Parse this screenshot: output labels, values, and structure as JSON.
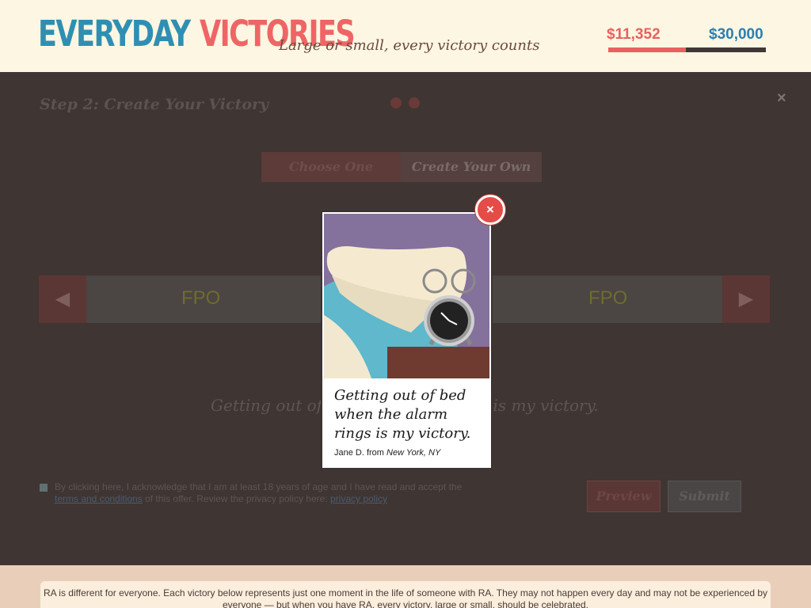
{
  "header": {
    "logo_word1": "EVERYDAY",
    "logo_word2": "VICTORIES",
    "tagline": "Large or small, every victory counts",
    "raised": "$11,352",
    "goal": "$30,000",
    "progress_fraction": 0.49,
    "colors": {
      "brand_blue": "#2f8fb3",
      "brand_red": "#ef6565"
    }
  },
  "wizard": {
    "step_title": "Step 2: Create Your Victory",
    "close_icon": "×",
    "tabs": [
      "Choose One",
      "Create Your Own"
    ],
    "carousel": {
      "prev_icon": "◀",
      "next_icon": "▶",
      "items": [
        "FPO",
        "FPO"
      ]
    },
    "preview_text_left": "Getting out of b",
    "preview_text_right": "gs is my victory.",
    "consent": {
      "text_1": "By clicking here, I acknowledge that I am at least 18 years of age and I have read and accept the",
      "terms_link": "terms and conditions",
      "text_2": "of this offer. Review the privacy policy here:",
      "privacy_link": "privacy policy"
    },
    "buttons": {
      "preview": "Preview",
      "submit": "Submit"
    }
  },
  "modal": {
    "close_icon": "×",
    "quote": "Getting out of bed when the alarm rings is my victory.",
    "author": "Jane D. from",
    "location": "New York, NY",
    "illustration": "alarm-clock-bed"
  },
  "footer": {
    "note": "RA is different for everyone. Each victory below represents just one moment in the life of someone with RA. They may not happen every day and may not be experienced by everyone — but when you have RA, every victory, large or small, should be celebrated."
  }
}
